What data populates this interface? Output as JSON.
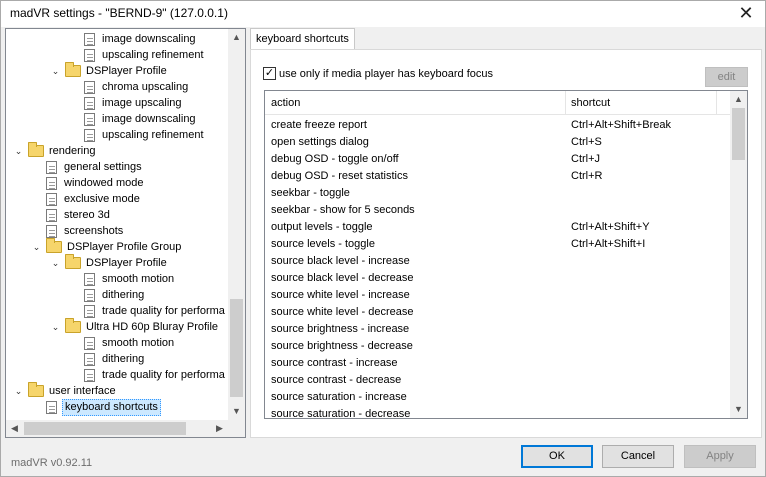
{
  "window": {
    "title": "madVR settings - \"BERND-9\" (127.0.0.1)"
  },
  "tree": {
    "items": [
      {
        "label": "image downscaling",
        "level": 3,
        "kind": "page"
      },
      {
        "label": "upscaling refinement",
        "level": 3,
        "kind": "page"
      },
      {
        "label": "DSPlayer Profile",
        "level": 2,
        "kind": "folder",
        "expander": "collapse"
      },
      {
        "label": "chroma upscaling",
        "level": 3,
        "kind": "page"
      },
      {
        "label": "image upscaling",
        "level": 3,
        "kind": "page"
      },
      {
        "label": "image downscaling",
        "level": 3,
        "kind": "page"
      },
      {
        "label": "upscaling refinement",
        "level": 3,
        "kind": "page"
      },
      {
        "label": "rendering",
        "level": 0,
        "kind": "folder",
        "expander": "collapse"
      },
      {
        "label": "general settings",
        "level": 1,
        "kind": "page"
      },
      {
        "label": "windowed mode",
        "level": 1,
        "kind": "page"
      },
      {
        "label": "exclusive mode",
        "level": 1,
        "kind": "page"
      },
      {
        "label": "stereo 3d",
        "level": 1,
        "kind": "page"
      },
      {
        "label": "screenshots",
        "level": 1,
        "kind": "page"
      },
      {
        "label": "DSPlayer Profile Group",
        "level": 1,
        "kind": "folder",
        "expander": "collapse"
      },
      {
        "label": "DSPlayer Profile",
        "level": 2,
        "kind": "folder",
        "expander": "collapse"
      },
      {
        "label": "smooth motion",
        "level": 3,
        "kind": "page"
      },
      {
        "label": "dithering",
        "level": 3,
        "kind": "page"
      },
      {
        "label": "trade quality for performa",
        "level": 3,
        "kind": "page"
      },
      {
        "label": "Ultra HD 60p Bluray Profile",
        "level": 2,
        "kind": "folder",
        "expander": "collapse"
      },
      {
        "label": "smooth motion",
        "level": 3,
        "kind": "page"
      },
      {
        "label": "dithering",
        "level": 3,
        "kind": "page"
      },
      {
        "label": "trade quality for performa",
        "level": 3,
        "kind": "page"
      },
      {
        "label": "user interface",
        "level": 0,
        "kind": "folder",
        "expander": "collapse"
      },
      {
        "label": "keyboard shortcuts",
        "level": 1,
        "kind": "page",
        "selected": true
      }
    ]
  },
  "tab": {
    "label": "keyboard shortcuts"
  },
  "focus_checkbox": {
    "label": "use only if media player has keyboard focus",
    "checked": true,
    "mark": "✓"
  },
  "edit_button": {
    "label": "edit",
    "enabled": false
  },
  "shortcuts": {
    "columns": {
      "action": "action",
      "shortcut": "shortcut"
    },
    "rows": [
      {
        "action": "create freeze report",
        "shortcut": "Ctrl+Alt+Shift+Break"
      },
      {
        "action": "open settings dialog",
        "shortcut": "Ctrl+S"
      },
      {
        "action": "debug OSD - toggle on/off",
        "shortcut": "Ctrl+J"
      },
      {
        "action": "debug OSD - reset statistics",
        "shortcut": "Ctrl+R"
      },
      {
        "action": "seekbar - toggle",
        "shortcut": ""
      },
      {
        "action": "seekbar - show for 5 seconds",
        "shortcut": ""
      },
      {
        "action": "output levels - toggle",
        "shortcut": "Ctrl+Alt+Shift+Y"
      },
      {
        "action": "source levels - toggle",
        "shortcut": "Ctrl+Alt+Shift+I"
      },
      {
        "action": "source black level - increase",
        "shortcut": ""
      },
      {
        "action": "source black level - decrease",
        "shortcut": ""
      },
      {
        "action": "source white level - increase",
        "shortcut": ""
      },
      {
        "action": "source white level - decrease",
        "shortcut": ""
      },
      {
        "action": "source brightness - increase",
        "shortcut": ""
      },
      {
        "action": "source brightness - decrease",
        "shortcut": ""
      },
      {
        "action": "source contrast - increase",
        "shortcut": ""
      },
      {
        "action": "source contrast - decrease",
        "shortcut": ""
      },
      {
        "action": "source saturation - increase",
        "shortcut": ""
      },
      {
        "action": "source saturation - decrease",
        "shortcut": ""
      }
    ]
  },
  "footer": {
    "version": "madVR v0.92.11",
    "ok_label": "OK",
    "cancel_label": "Cancel",
    "apply_label": "Apply"
  },
  "icons": {
    "close": "close-icon",
    "expander": "expander-icon",
    "folder": "folder-icon",
    "page": "settings-page-icon",
    "arrows": [
      "scroll-up-icon",
      "scroll-down-icon",
      "scroll-left-icon",
      "scroll-right-icon"
    ]
  },
  "colors": {
    "selection": "#cce8ff",
    "default_button_border": "#0078d7",
    "folder": "#f6d56b"
  }
}
